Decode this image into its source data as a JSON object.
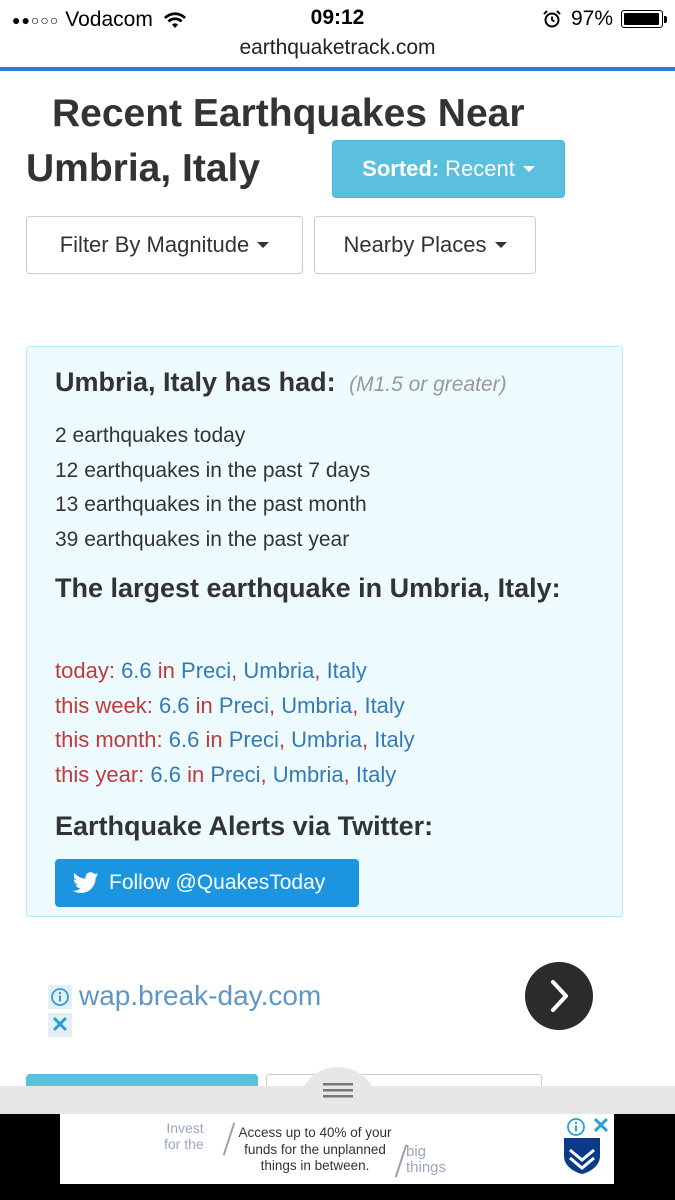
{
  "status_bar": {
    "carrier": "Vodacom",
    "time": "09:12",
    "battery_text": "97%",
    "battery_level": 0.97,
    "icons": [
      "signal-dots-icon",
      "wifi-icon",
      "alarm-icon",
      "battery-icon"
    ]
  },
  "browser": {
    "url": "earthquaketrack.com",
    "accent_color": "#2a7fe0"
  },
  "page": {
    "title_line1": "Recent Earthquakes Near",
    "title_line2": "Umbria, Italy",
    "sorted_label": "Sorted:",
    "sorted_value": "Recent",
    "filter_magnitude": "Filter By Magnitude",
    "nearby_places": "Nearby Places"
  },
  "stats": {
    "heading": "Umbria, Italy has had:",
    "qualifier": "(M1.5 or greater)",
    "counts": [
      "2 earthquakes today",
      "12 earthquakes in the past 7 days",
      "13 earthquakes in the past month",
      "39 earthquakes in the past year"
    ],
    "largest_heading": "The largest earthquake in Umbria, Italy:",
    "largest": [
      {
        "period": "today:",
        "magnitude": "6.6",
        "in": "in",
        "place": "Preci",
        "region": "Umbria",
        "country": "Italy"
      },
      {
        "period": "this week:",
        "magnitude": "6.6",
        "in": "in",
        "place": "Preci",
        "region": "Umbria",
        "country": "Italy"
      },
      {
        "period": "this month:",
        "magnitude": "6.6",
        "in": "in",
        "place": "Preci",
        "region": "Umbria",
        "country": "Italy"
      },
      {
        "period": "this year:",
        "magnitude": "6.6",
        "in": "in",
        "place": "Preci",
        "region": "Umbria",
        "country": "Italy"
      }
    ],
    "comma": ",",
    "alerts_heading": "Earthquake Alerts via Twitter:",
    "follow_button": "Follow @QuakesToday"
  },
  "ad": {
    "url": "wap.break-day.com",
    "close": "✕"
  },
  "banner": {
    "invest": "Invest\nfor the",
    "main": "Access up to 40% of your funds for the unplanned things in between.",
    "big_things": "big\nthings",
    "close": "✕"
  },
  "colors": {
    "info_bg": "#eefbfe",
    "info_border": "#bce8f1",
    "button_info": "#5bc0de",
    "twitter_blue": "#1b95e0",
    "period_red": "#c0393b",
    "link_blue": "#337ab7"
  }
}
